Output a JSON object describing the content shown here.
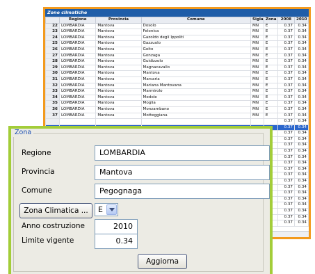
{
  "zone_window": {
    "title": "Zone climatiche",
    "columns": [
      "Regione",
      "Provincia",
      "Comune",
      "Sigla",
      "Zona",
      "2008",
      "2010"
    ],
    "rows": [
      {
        "n": "22",
        "regione": "LOMBARDIA",
        "provincia": "Mantova",
        "comune": "Dosolo",
        "sigla": "MN",
        "zona": "E",
        "y2008": "0.37",
        "y2010": "0.34"
      },
      {
        "n": "23",
        "regione": "LOMBARDIA",
        "provincia": "Mantova",
        "comune": "Felonica",
        "sigla": "MN",
        "zona": "E",
        "y2008": "0.37",
        "y2010": "0.34"
      },
      {
        "n": "24",
        "regione": "LOMBARDIA",
        "provincia": "Mantova",
        "comune": "Gazoldo degli Ippoliti",
        "sigla": "MN",
        "zona": "E",
        "y2008": "0.37",
        "y2010": "0.34"
      },
      {
        "n": "25",
        "regione": "LOMBARDIA",
        "provincia": "Mantova",
        "comune": "Gazzuolo",
        "sigla": "MN",
        "zona": "E",
        "y2008": "0.37",
        "y2010": "0.34"
      },
      {
        "n": "26",
        "regione": "LOMBARDIA",
        "provincia": "Mantova",
        "comune": "Goito",
        "sigla": "MN",
        "zona": "E",
        "y2008": "0.37",
        "y2010": "0.34"
      },
      {
        "n": "27",
        "regione": "LOMBARDIA",
        "provincia": "Mantova",
        "comune": "Gonzaga",
        "sigla": "MN",
        "zona": "E",
        "y2008": "0.37",
        "y2010": "0.34"
      },
      {
        "n": "28",
        "regione": "LOMBARDIA",
        "provincia": "Mantova",
        "comune": "Guidizzolo",
        "sigla": "MN",
        "zona": "E",
        "y2008": "0.37",
        "y2010": "0.34"
      },
      {
        "n": "29",
        "regione": "LOMBARDIA",
        "provincia": "Mantova",
        "comune": "Magnacavallo",
        "sigla": "MN",
        "zona": "E",
        "y2008": "0.37",
        "y2010": "0.34"
      },
      {
        "n": "30",
        "regione": "LOMBARDIA",
        "provincia": "Mantova",
        "comune": "Mantova",
        "sigla": "MN",
        "zona": "E",
        "y2008": "0.37",
        "y2010": "0.34"
      },
      {
        "n": "31",
        "regione": "LOMBARDIA",
        "provincia": "Mantova",
        "comune": "Marcaria",
        "sigla": "MN",
        "zona": "E",
        "y2008": "0.37",
        "y2010": "0.34"
      },
      {
        "n": "32",
        "regione": "LOMBARDIA",
        "provincia": "Mantova",
        "comune": "Mariana Mantovana",
        "sigla": "MN",
        "zona": "E",
        "y2008": "0.37",
        "y2010": "0.34"
      },
      {
        "n": "33",
        "regione": "LOMBARDIA",
        "provincia": "Mantova",
        "comune": "Marmirolo",
        "sigla": "MN",
        "zona": "E",
        "y2008": "0.37",
        "y2010": "0.34"
      },
      {
        "n": "34",
        "regione": "LOMBARDIA",
        "provincia": "Mantova",
        "comune": "Medole",
        "sigla": "MN",
        "zona": "E",
        "y2008": "0.37",
        "y2010": "0.34"
      },
      {
        "n": "35",
        "regione": "LOMBARDIA",
        "provincia": "Mantova",
        "comune": "Moglia",
        "sigla": "MN",
        "zona": "E",
        "y2008": "0.37",
        "y2010": "0.34"
      },
      {
        "n": "36",
        "regione": "LOMBARDIA",
        "provincia": "Mantova",
        "comune": "Monzambano",
        "sigla": "MN",
        "zona": "E",
        "y2008": "0.37",
        "y2010": "0.34"
      },
      {
        "n": "37",
        "regione": "LOMBARDIA",
        "provincia": "Mantova",
        "comune": "Motteggiana",
        "sigla": "MN",
        "zona": "E",
        "y2008": "0.37",
        "y2010": "0.34"
      }
    ],
    "tail_rows": [
      {
        "y2008": "0.37",
        "y2010": "0.34"
      },
      {
        "y2008": "0.37",
        "y2010": "0.34",
        "highlight": true
      },
      {
        "y2008": "0.37",
        "y2010": "0.34"
      },
      {
        "y2008": "0.37",
        "y2010": "0.34"
      },
      {
        "y2008": "0.37",
        "y2010": "0.34"
      },
      {
        "y2008": "0.37",
        "y2010": "0.34"
      },
      {
        "y2008": "0.37",
        "y2010": "0.34"
      },
      {
        "y2008": "0.37",
        "y2010": "0.34"
      },
      {
        "y2008": "0.37",
        "y2010": "0.34"
      },
      {
        "y2008": "0.37",
        "y2010": "0.34"
      },
      {
        "y2008": "0.37",
        "y2010": "0.34"
      },
      {
        "y2008": "0.37",
        "y2010": "0.34"
      },
      {
        "y2008": "0.37",
        "y2010": "0.34"
      },
      {
        "y2008": "0.37",
        "y2010": "0.34"
      },
      {
        "y2008": "0.37",
        "y2010": "0.34"
      },
      {
        "y2008": "0.37",
        "y2010": "0.34"
      },
      {
        "y2008": "0.37",
        "y2010": "0.34"
      },
      {
        "y2008": "0.37",
        "y2010": "0.34"
      }
    ]
  },
  "zona_panel": {
    "legend": "Zona",
    "regione_label": "Regione",
    "regione_value": "LOMBARDIA",
    "provincia_label": "Provincia",
    "provincia_value": "Mantova",
    "comune_label": "Comune",
    "comune_value": "Pegognaga",
    "zona_button": "Zona Climatica ...",
    "zona_select_value": "E",
    "anno_label": "Anno costruzione",
    "anno_value": "2010",
    "limite_label": "Limite vigente",
    "limite_value": "0.34",
    "aggiorna_button": "Aggiorna"
  },
  "colors": {
    "back_frame": "#f39a1e",
    "front_frame": "#a3cd39",
    "title_bar": "#1f5da8",
    "highlight": "#2b66cc",
    "legend_text": "#1c4fb3"
  }
}
